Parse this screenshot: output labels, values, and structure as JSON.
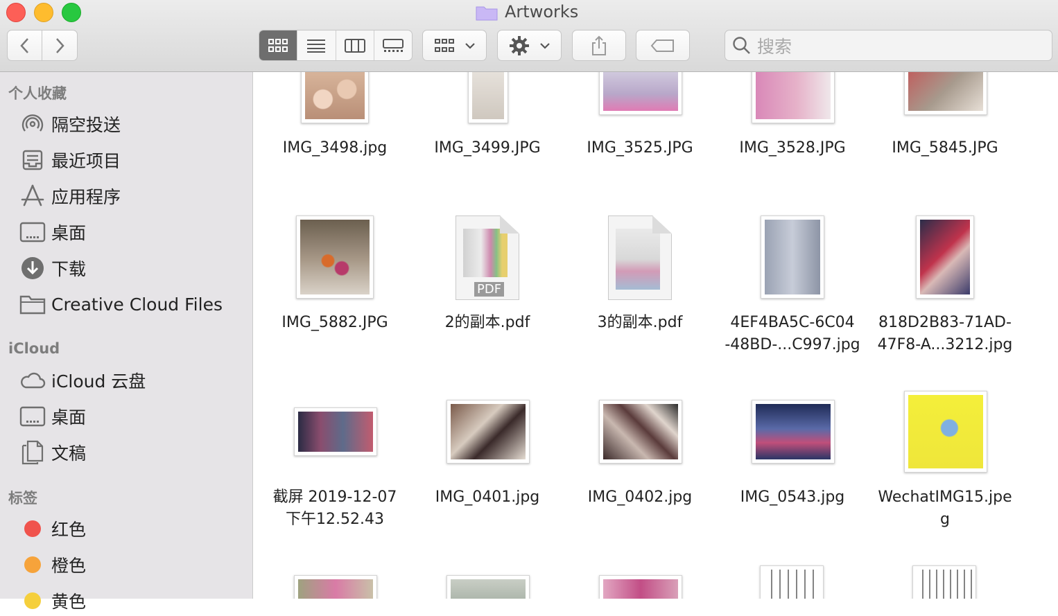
{
  "window": {
    "title": "Artworks",
    "search_placeholder": "搜索"
  },
  "toolbar": {
    "view_modes": [
      "icon-view",
      "list-view",
      "column-view",
      "gallery-view"
    ],
    "active_view": "icon-view"
  },
  "sidebar": {
    "favorites_header": "个人收藏",
    "favorites": [
      {
        "label": "隔空投送",
        "icon": "airdrop-icon"
      },
      {
        "label": "最近项目",
        "icon": "recents-icon"
      },
      {
        "label": "应用程序",
        "icon": "applications-icon"
      },
      {
        "label": "桌面",
        "icon": "desktop-icon"
      },
      {
        "label": "下载",
        "icon": "downloads-icon"
      },
      {
        "label": "Creative Cloud Files",
        "icon": "folder-icon"
      }
    ],
    "icloud_header": "iCloud",
    "icloud": [
      {
        "label": "iCloud 云盘",
        "icon": "cloud-icon"
      },
      {
        "label": "桌面",
        "icon": "desktop-icon"
      },
      {
        "label": "文稿",
        "icon": "documents-icon"
      }
    ],
    "tags_header": "标签",
    "tags": [
      {
        "label": "红色",
        "color": "#f0534d"
      },
      {
        "label": "橙色",
        "color": "#f6a33b"
      },
      {
        "label": "黄色",
        "color": "#f5cf3c"
      }
    ]
  },
  "files": {
    "row1": [
      "IMG_3498.jpg",
      "IMG_3499.JPG",
      "IMG_3525.JPG",
      "IMG_3528.JPG",
      "IMG_5845.JPG"
    ],
    "row2": [
      "IMG_5882.JPG",
      "2的副本.pdf",
      "3的副本.pdf",
      "4EF4BA5C-6C04\n-48BD-...C997.jpg",
      "818D2B83-71AD-\n47F8-A...3212.jpg"
    ],
    "row3": [
      "截屏 2019-12-07\n下午12.52.43",
      "IMG_0401.jpg",
      "IMG_0402.jpg",
      "IMG_0543.jpg",
      "WechatIMG15.jpe\ng"
    ],
    "pdf_badge": "PDF"
  }
}
